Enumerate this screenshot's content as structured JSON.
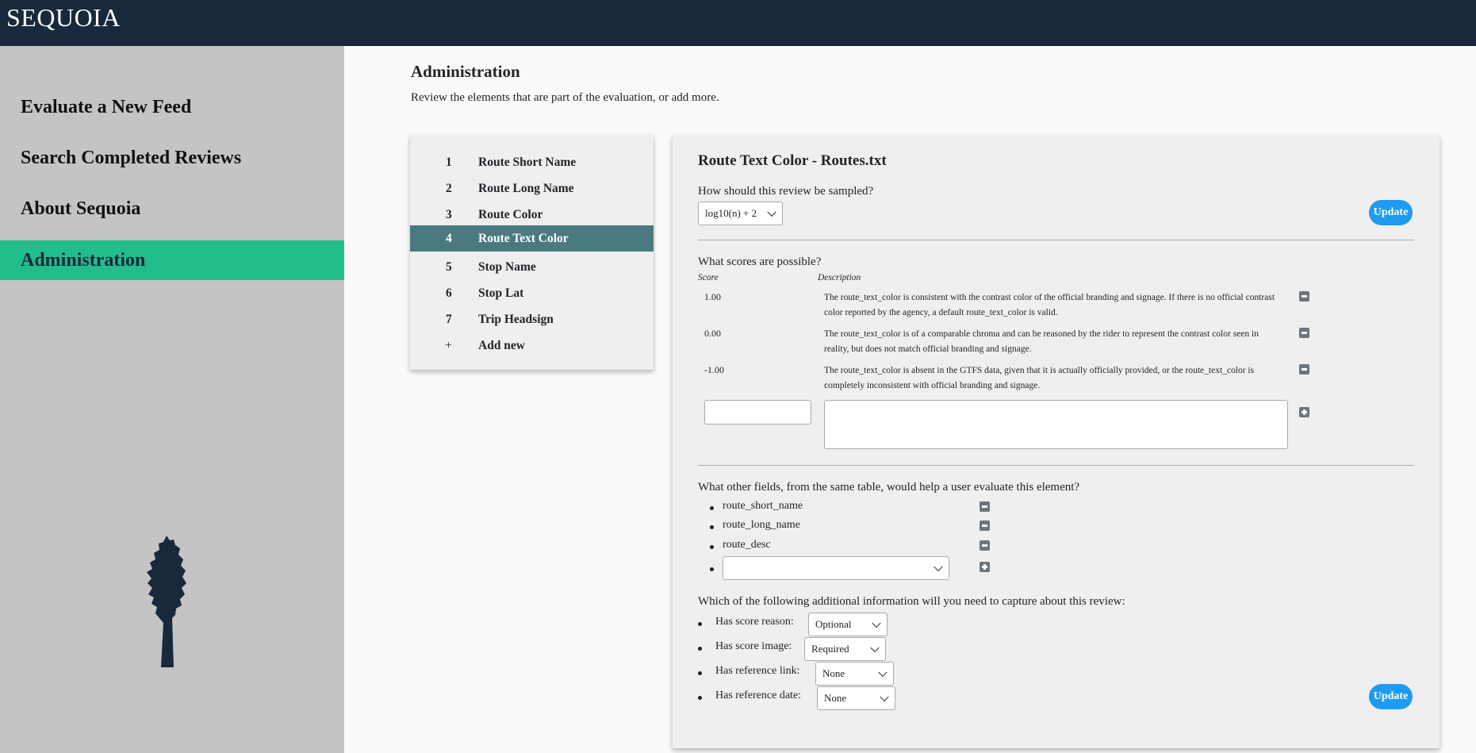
{
  "app": {
    "brand": "SEQUOIA"
  },
  "sidebar": {
    "items": [
      {
        "label": "Evaluate a New Feed"
      },
      {
        "label": "Search Completed Reviews"
      },
      {
        "label": "About Sequoia"
      },
      {
        "label": "Administration",
        "active": true
      }
    ],
    "tree_icon": "sequoia-tree-icon"
  },
  "page": {
    "title": "Administration",
    "subtitle": "Review the elements that are part of the evaluation, or add more."
  },
  "elements": {
    "items": [
      {
        "num": "1",
        "label": "Route Short Name"
      },
      {
        "num": "2",
        "label": "Route Long Name"
      },
      {
        "num": "3",
        "label": "Route Color"
      },
      {
        "num": "4",
        "label": "Route Text Color"
      },
      {
        "num": "5",
        "label": "Stop Name"
      },
      {
        "num": "6",
        "label": "Stop Lat"
      },
      {
        "num": "7",
        "label": "Trip Headsign"
      }
    ],
    "selected_index": 3,
    "add_new": {
      "symbol": "+",
      "label": "Add new"
    }
  },
  "detail": {
    "title": "Route Text Color - Routes.txt",
    "sampling": {
      "question": "How should this review be sampled?",
      "selected": "log10(n) + 2"
    },
    "update_label": "Update",
    "scores": {
      "question": "What scores are possible?",
      "score_header": "Score",
      "description_header": "Description",
      "rows": [
        {
          "score": "1.00",
          "description": "The route_text_color is consistent with the contrast color of the official branding and signage. If there is no official contrast color reported by the agency, a default route_text_color is valid."
        },
        {
          "score": "0.00",
          "description": "The route_text_color is of a comparable chroma and can be reasoned by the rider to represent the contrast color seen in reality, but does not match official branding and signage."
        },
        {
          "score": "-1.00",
          "description": "The route_text_color is absent in the GTFS data, given that it is actually officially provided, or the route_text_color is completely inconsistent with official branding and signage."
        }
      ],
      "new_score_value": "",
      "new_description_value": ""
    },
    "fields": {
      "question": "What other fields, from the same table, would help a user evaluate this element?",
      "items": [
        "route_short_name",
        "route_long_name",
        "route_desc"
      ],
      "new_field_selected": ""
    },
    "additional": {
      "question": "Which of the following additional information will you need to capture about this review:",
      "items": [
        {
          "label": "Has score reason:",
          "value": "Optional"
        },
        {
          "label": "Has score image:",
          "value": "Required"
        },
        {
          "label": "Has reference link:",
          "value": "None"
        },
        {
          "label": "Has reference date:",
          "value": "None"
        }
      ]
    }
  },
  "colors": {
    "topbar": "#17293a",
    "sidebar": "#c4c4c4",
    "sidebar_active": "#22bd8a",
    "element_active": "#4a7a80",
    "update_button": "#1e9bf0"
  }
}
